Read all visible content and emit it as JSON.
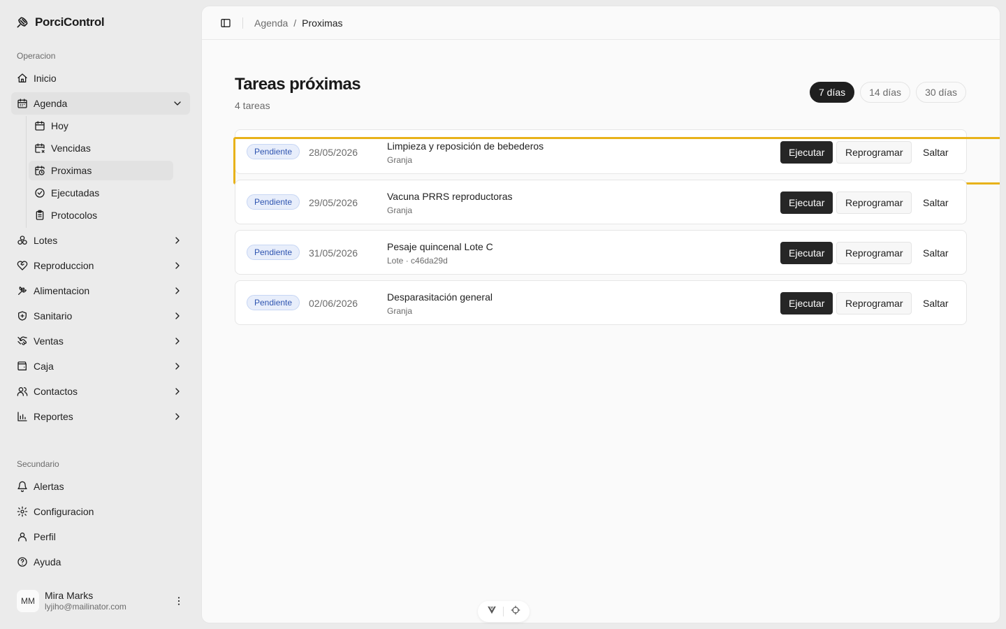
{
  "brand": {
    "name": "PorciControl"
  },
  "sidebar": {
    "group_operacion": "Operacion",
    "group_secundario": "Secundario",
    "inicio": "Inicio",
    "agenda": "Agenda",
    "agenda_sub": {
      "hoy": "Hoy",
      "vencidas": "Vencidas",
      "proximas": "Proximas",
      "ejecutadas": "Ejecutadas",
      "protocolos": "Protocolos"
    },
    "lotes": "Lotes",
    "reproduccion": "Reproduccion",
    "alimentacion": "Alimentacion",
    "sanitario": "Sanitario",
    "ventas": "Ventas",
    "caja": "Caja",
    "contactos": "Contactos",
    "reportes": "Reportes",
    "alertas": "Alertas",
    "configuracion": "Configuracion",
    "perfil": "Perfil",
    "ayuda": "Ayuda"
  },
  "user": {
    "initials": "MM",
    "name": "Mira Marks",
    "email": "lyjiho@mailinator.com"
  },
  "breadcrumb": {
    "parent": "Agenda",
    "separator": "/",
    "current": "Proximas"
  },
  "page": {
    "title": "Tareas próximas",
    "subtitle": "4 tareas"
  },
  "range": {
    "d7": "7 días",
    "d14": "14 días",
    "d30": "30 días",
    "selected": "7 días"
  },
  "actions": {
    "execute": "Ejecutar",
    "reschedule": "Reprogramar",
    "skip": "Saltar"
  },
  "tasks": [
    {
      "status": "Pendiente",
      "date": "28/05/2026",
      "title": "Limpieza y reposición de bebederos",
      "meta": "Granja"
    },
    {
      "status": "Pendiente",
      "date": "29/05/2026",
      "title": "Vacuna PRRS reproductoras",
      "meta": "Granja"
    },
    {
      "status": "Pendiente",
      "date": "31/05/2026",
      "title": "Pesaje quincenal Lote C",
      "meta": "Lote · c46da29d"
    },
    {
      "status": "Pendiente",
      "date": "02/06/2026",
      "title": "Desparasitación general",
      "meta": "Granja"
    }
  ],
  "colors": {
    "accent_dark": "#262626",
    "badge_blue": "#2f55b0",
    "highlight": "#e8b21a"
  }
}
